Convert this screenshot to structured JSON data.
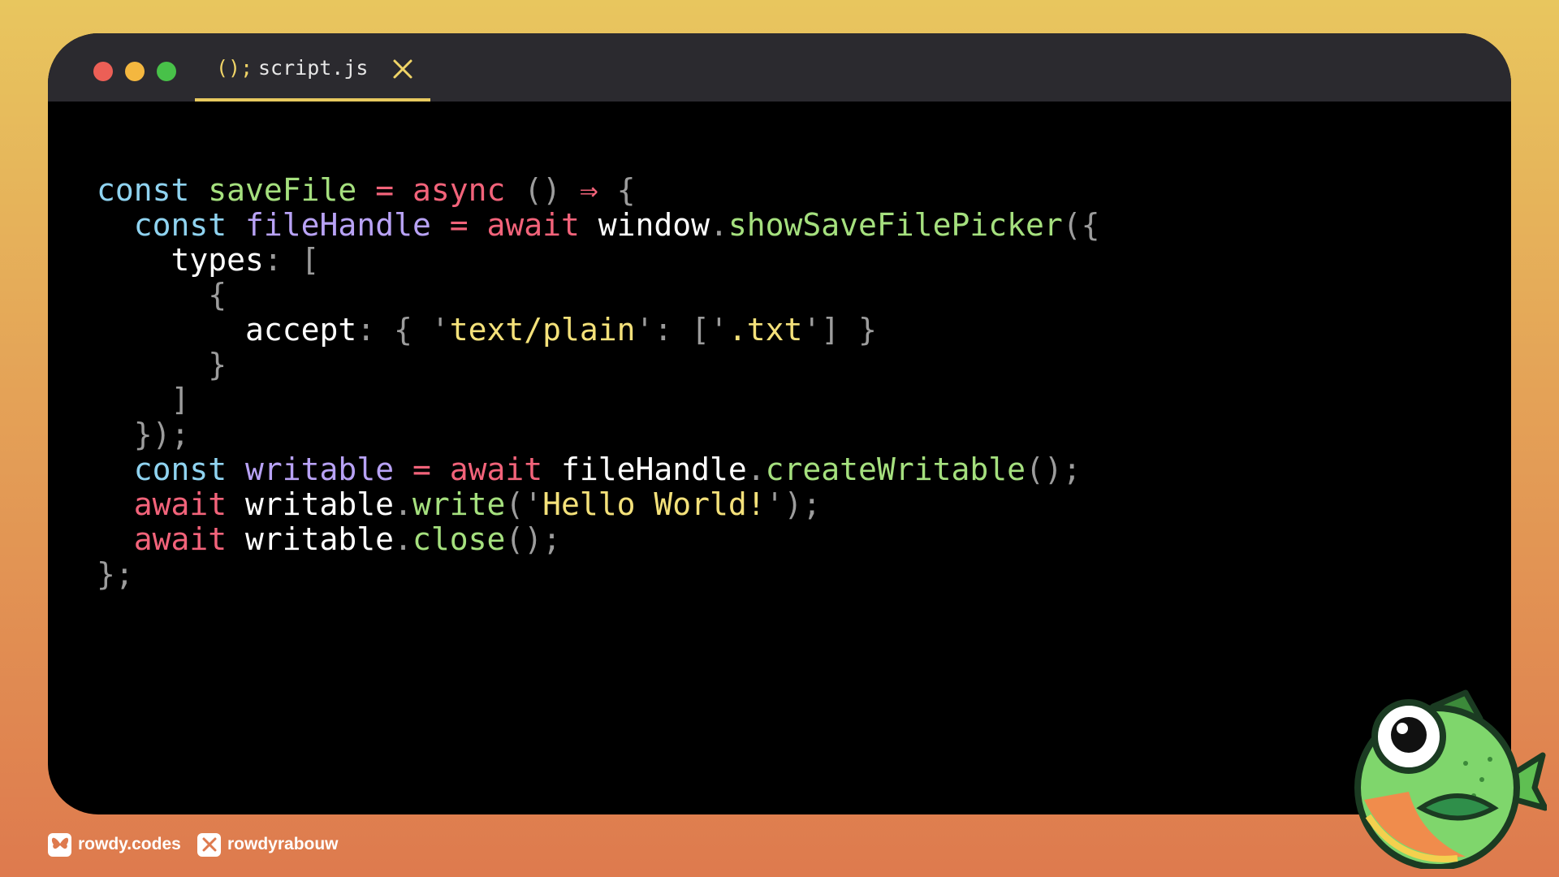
{
  "tab": {
    "icon_text": "();",
    "filename": "script.js"
  },
  "code": {
    "lines": [
      [
        {
          "t": "const",
          "c": "kw"
        },
        {
          "t": " ",
          "c": "id"
        },
        {
          "t": "saveFile",
          "c": "fn"
        },
        {
          "t": " = ",
          "c": "op"
        },
        {
          "t": "async",
          "c": "op"
        },
        {
          "t": " () ",
          "c": "punc"
        },
        {
          "t": "⇒",
          "c": "op"
        },
        {
          "t": " {",
          "c": "punc"
        }
      ],
      [
        {
          "t": "  ",
          "c": "id"
        },
        {
          "t": "const",
          "c": "kw"
        },
        {
          "t": " ",
          "c": "id"
        },
        {
          "t": "fileHandle",
          "c": "var"
        },
        {
          "t": " = ",
          "c": "op"
        },
        {
          "t": "await",
          "c": "op"
        },
        {
          "t": " window",
          "c": "id"
        },
        {
          "t": ".",
          "c": "punc"
        },
        {
          "t": "showSaveFilePicker",
          "c": "fn"
        },
        {
          "t": "({",
          "c": "punc"
        }
      ],
      [
        {
          "t": "    types",
          "c": "id"
        },
        {
          "t": ": [",
          "c": "punc"
        }
      ],
      [
        {
          "t": "      {",
          "c": "punc"
        }
      ],
      [
        {
          "t": "        accept",
          "c": "id"
        },
        {
          "t": ": { '",
          "c": "punc"
        },
        {
          "t": "text/plain",
          "c": "str"
        },
        {
          "t": "': ['",
          "c": "punc"
        },
        {
          "t": ".txt",
          "c": "str"
        },
        {
          "t": "'] }",
          "c": "punc"
        }
      ],
      [
        {
          "t": "      }",
          "c": "punc"
        }
      ],
      [
        {
          "t": "    ]",
          "c": "punc"
        }
      ],
      [
        {
          "t": "  });",
          "c": "punc"
        }
      ],
      [
        {
          "t": "  ",
          "c": "id"
        },
        {
          "t": "const",
          "c": "kw"
        },
        {
          "t": " ",
          "c": "id"
        },
        {
          "t": "writable",
          "c": "var"
        },
        {
          "t": " = ",
          "c": "op"
        },
        {
          "t": "await",
          "c": "op"
        },
        {
          "t": " fileHandle",
          "c": "id"
        },
        {
          "t": ".",
          "c": "punc"
        },
        {
          "t": "createWritable",
          "c": "fn"
        },
        {
          "t": "();",
          "c": "punc"
        }
      ],
      [
        {
          "t": "  ",
          "c": "id"
        },
        {
          "t": "await",
          "c": "op"
        },
        {
          "t": " writable",
          "c": "id"
        },
        {
          "t": ".",
          "c": "punc"
        },
        {
          "t": "write",
          "c": "fn"
        },
        {
          "t": "('",
          "c": "punc"
        },
        {
          "t": "Hello World!",
          "c": "str"
        },
        {
          "t": "');",
          "c": "punc"
        }
      ],
      [
        {
          "t": "  ",
          "c": "id"
        },
        {
          "t": "await",
          "c": "op"
        },
        {
          "t": " writable",
          "c": "id"
        },
        {
          "t": ".",
          "c": "punc"
        },
        {
          "t": "close",
          "c": "fn"
        },
        {
          "t": "();",
          "c": "punc"
        }
      ],
      [
        {
          "t": "};",
          "c": "punc"
        }
      ]
    ]
  },
  "footer": {
    "bluesky_handle": "rowdy.codes",
    "x_handle": "rowdyrabouw"
  },
  "icons": {
    "bluesky": "butterfly-icon",
    "x": "x-logo-icon",
    "close": "close-icon"
  },
  "colors": {
    "keyword": "#8fd3f0",
    "function": "#a5e07e",
    "variable": "#b8a2f5",
    "operator": "#f2637a",
    "string": "#f4e17a",
    "punctuation": "#9c9c9c",
    "tab_accent": "#e7c95f",
    "traffic_red": "#ec5f56",
    "traffic_yellow": "#f4b73f",
    "traffic_green": "#48c149"
  }
}
